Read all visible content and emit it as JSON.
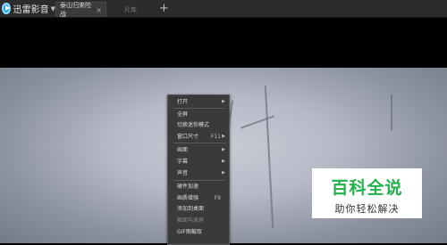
{
  "app": {
    "name": "迅雷影音"
  },
  "tabs": [
    {
      "label": "泰山归来险战",
      "close": "×"
    },
    {
      "label": "片库"
    }
  ],
  "add_tab": "+",
  "menu": {
    "items": [
      {
        "label": "打开",
        "submenu": true
      },
      {
        "label": "全屏"
      },
      {
        "label": "切换迷你模式"
      },
      {
        "label": "窗口尺寸",
        "shortcut": "F11",
        "submenu": true
      },
      {
        "label": "画面",
        "submenu": true
      },
      {
        "label": "字幕",
        "submenu": true
      },
      {
        "label": "声音",
        "submenu": true
      },
      {
        "label": "硬件加速"
      },
      {
        "label": "画质增强",
        "shortcut": "F9"
      },
      {
        "label": "添加到桌面"
      },
      {
        "label": "截图与录屏",
        "disabled": true
      },
      {
        "label": "GIF图截取"
      }
    ]
  },
  "watermark": {
    "title": "百科全说",
    "subtitle": "助你轻松解决"
  }
}
